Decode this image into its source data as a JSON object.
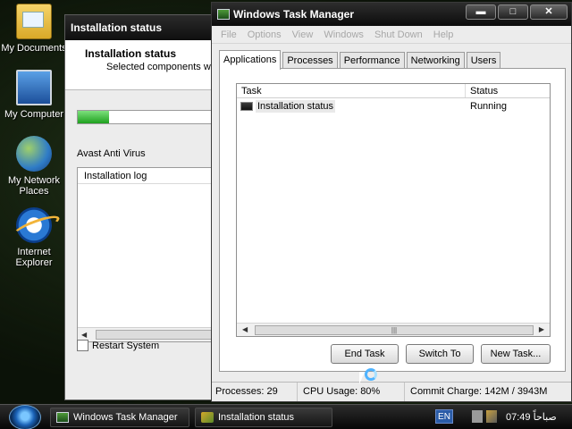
{
  "desktop": {
    "icons": [
      {
        "label": "My Documents"
      },
      {
        "label": "My Computer"
      },
      {
        "label": "My Network Places"
      },
      {
        "label": "Internet Explorer"
      }
    ]
  },
  "installer": {
    "title": "Installation status",
    "header_title": "Installation status",
    "header_subtitle": "Selected components wil",
    "progress_fraction": 0.21,
    "product": "Avast Anti Virus",
    "log_header": "Installation log",
    "restart_label": "Restart System",
    "restart_checked": false
  },
  "taskmgr": {
    "title": "Windows Task Manager",
    "controls": {
      "minimize": "▬",
      "maximize": "□",
      "close": "✕"
    },
    "menu": [
      "File",
      "Options",
      "View",
      "Windows",
      "Shut Down",
      "Help"
    ],
    "tabs": [
      "Applications",
      "Processes",
      "Performance",
      "Networking",
      "Users"
    ],
    "active_tab": "Applications",
    "columns": {
      "task": "Task",
      "status": "Status"
    },
    "rows": [
      {
        "task": "Installation status",
        "status": "Running"
      }
    ],
    "buttons": {
      "end_task": "End Task",
      "switch_to": "Switch To",
      "new_task": "New Task..."
    },
    "status": {
      "processes": "Processes: 29",
      "cpu": "CPU Usage: 80%",
      "commit": "Commit Charge: 142M / 3943M"
    }
  },
  "taskbar": {
    "buttons": [
      {
        "label": "Windows Task Manager"
      },
      {
        "label": "Installation status"
      }
    ],
    "language": "EN",
    "clock": "07:49 صباحاً"
  }
}
